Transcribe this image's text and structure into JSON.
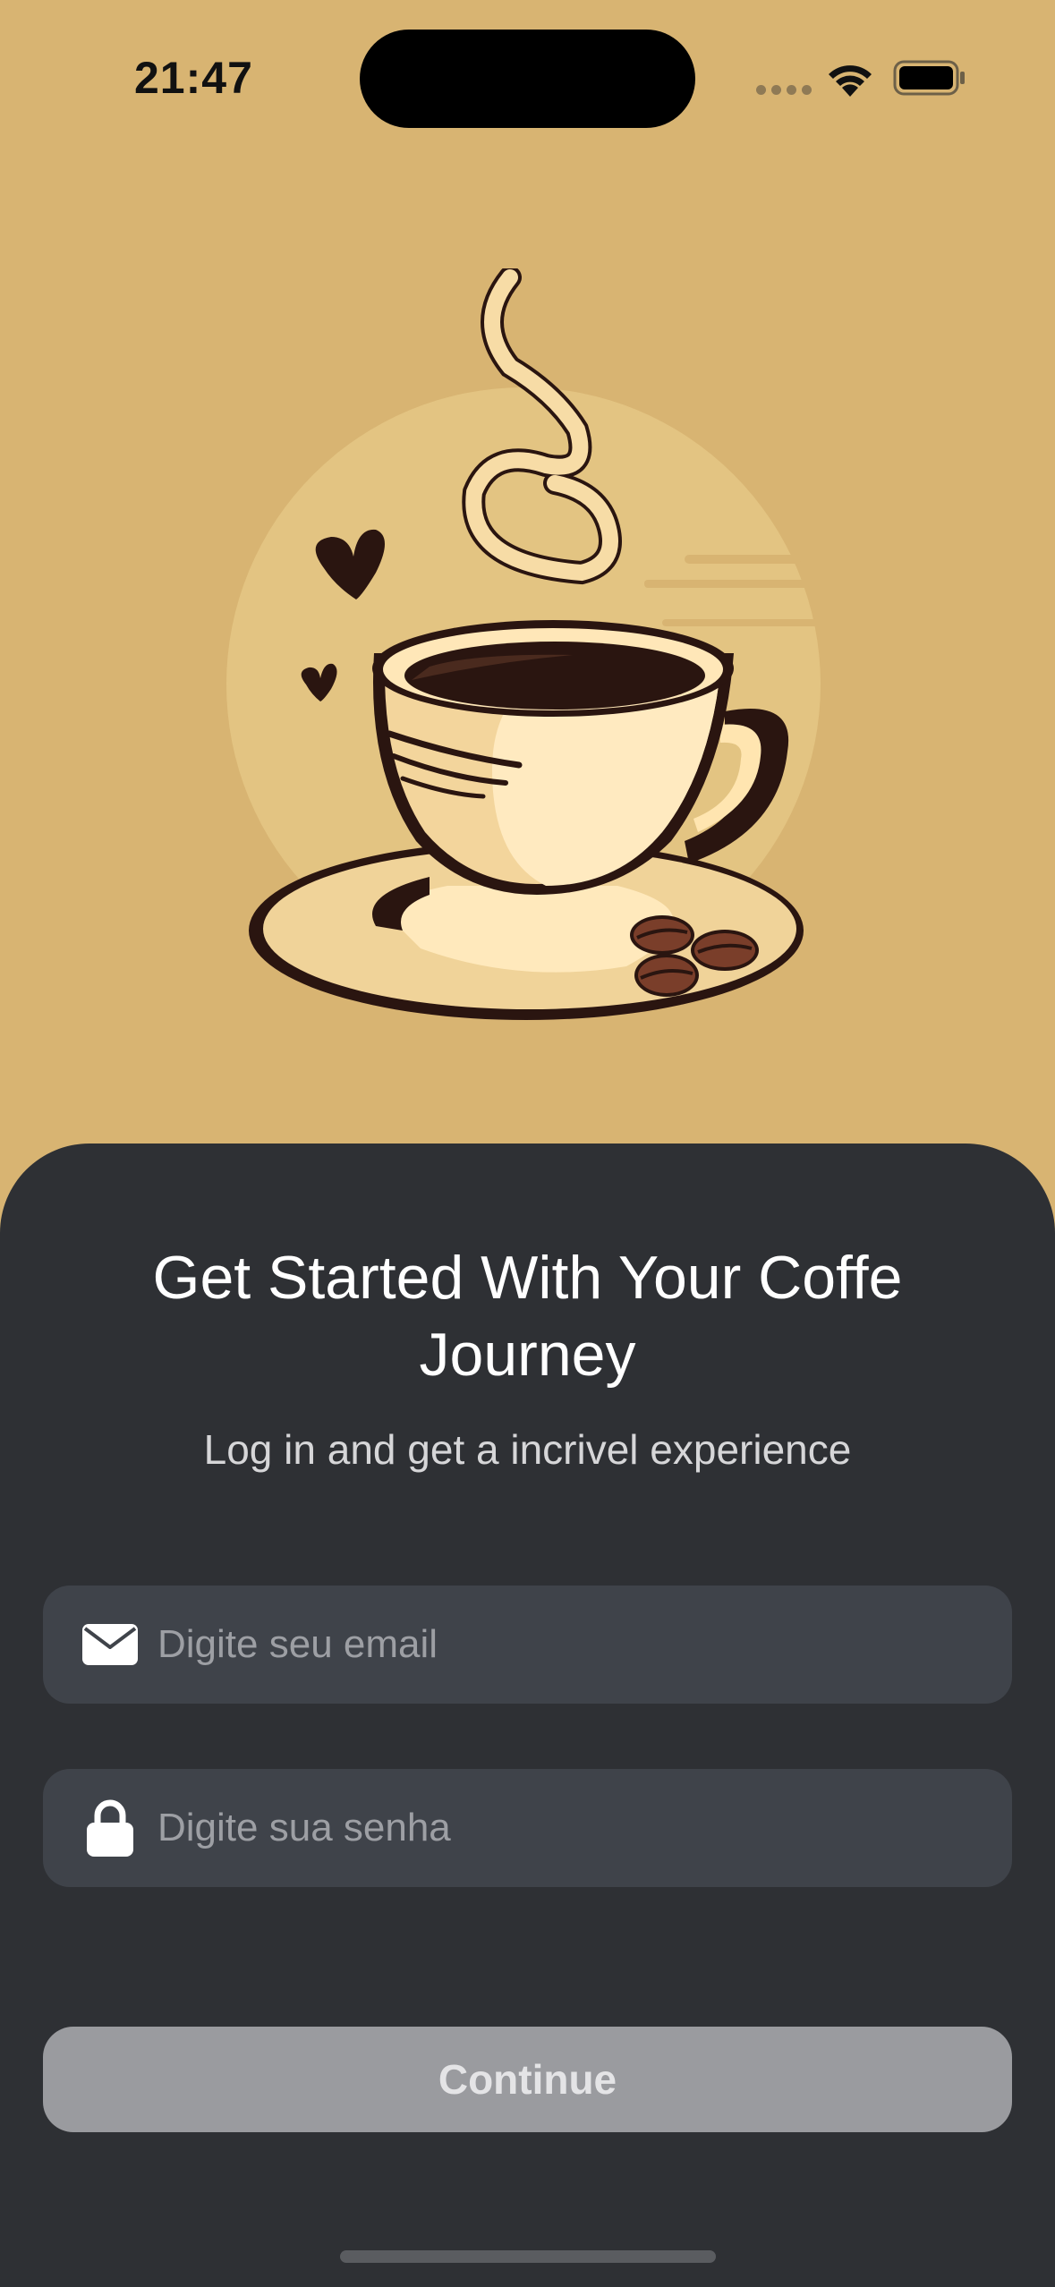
{
  "status_bar": {
    "time": "21:47"
  },
  "illustration": {
    "icon": "coffee-cup-illustration"
  },
  "login": {
    "title": "Get Started With Your Coffe Journey",
    "subtitle": "Log in and get a incrivel experience",
    "email_placeholder": "Digite seu email",
    "email_value": "",
    "password_placeholder": "Digite sua senha",
    "password_value": "",
    "continue_label": "Continue"
  },
  "colors": {
    "background": "#D8B472",
    "sheet": "#2E3034",
    "field": "#3F434A",
    "button": "#9A9B9F"
  }
}
